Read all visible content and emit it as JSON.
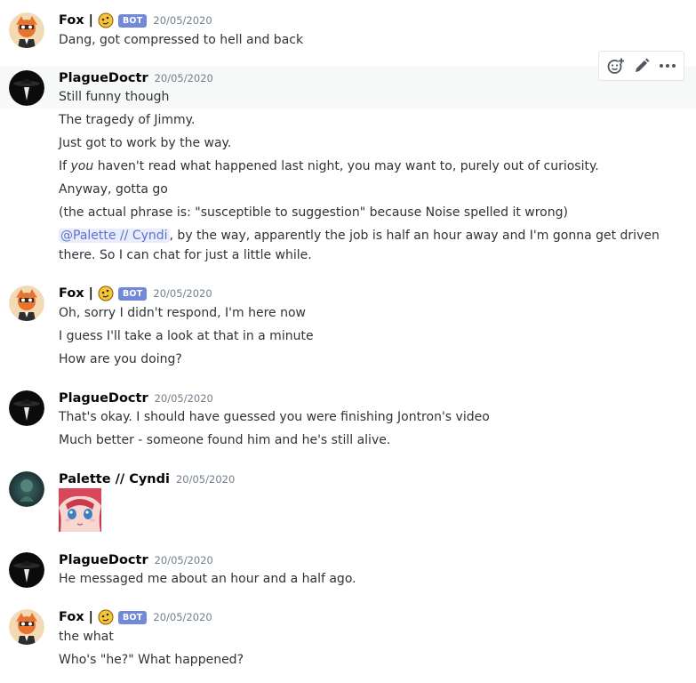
{
  "messages": [
    {
      "author": "Fox |",
      "bot_tag": "BOT",
      "timestamp": "20/05/2020",
      "lines": [
        "Dang, got compressed to hell and back"
      ]
    },
    {
      "author": "PlagueDoctr",
      "timestamp": "20/05/2020",
      "lines": [
        "Still funny though",
        "The tragedy of Jimmy.",
        "Just got to work by the way.",
        "If ",
        "you",
        " haven't read what happened last night, you may want to, purely out of curiosity.",
        "Anyway, gotta go",
        "(the actual phrase is: \"susceptible to suggestion\" because Noise spelled it wrong)",
        "@Palette // Cyndi",
        ", by the way, apparently the job is half an hour away and I'm gonna get driven",
        "there. So I can chat for just a little while."
      ]
    },
    {
      "author": "Fox |",
      "bot_tag": "BOT",
      "timestamp": "20/05/2020",
      "lines": [
        "Oh, sorry I didn't respond, I'm here now",
        "I guess I'll take a look at that in a minute",
        "How are you doing?"
      ]
    },
    {
      "author": "PlagueDoctr",
      "timestamp": "20/05/2020",
      "lines": [
        "That's okay. I should have guessed you were finishing Jontron's video",
        "Much better - someone found him and he's still alive."
      ]
    },
    {
      "author": "Palette // Cyndi",
      "timestamp": "20/05/2020",
      "lines": []
    },
    {
      "author": "PlagueDoctr",
      "timestamp": "20/05/2020",
      "lines": [
        "He messaged me about an hour and a half ago."
      ]
    },
    {
      "author": "Fox |",
      "bot_tag": "BOT",
      "timestamp": "20/05/2020",
      "lines": [
        "the what",
        "Who's \"he?\" What happened?"
      ]
    }
  ],
  "toolbar": {
    "icons": [
      "add-reaction-icon",
      "edit-pencil-icon",
      "more-options-icon"
    ]
  },
  "colors": {
    "mention_bg": "#e9ecfb",
    "mention_text": "#5e72d0",
    "bot_tag": "#7289da",
    "timestamp": "#747f8d",
    "hover_bg": "#f7f8f8"
  }
}
